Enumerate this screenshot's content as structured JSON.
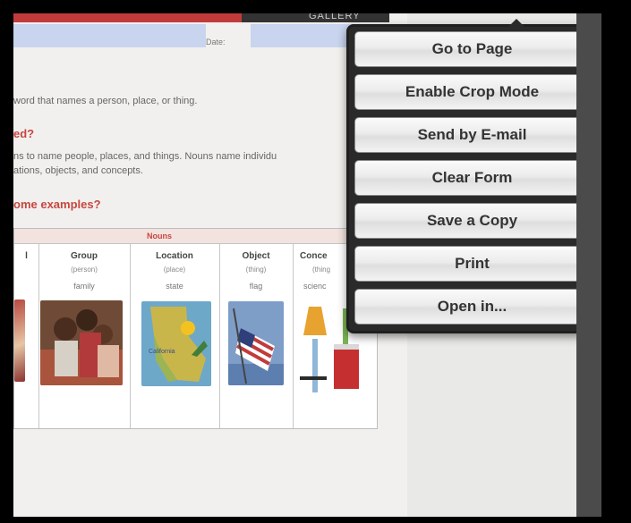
{
  "document": {
    "header_right_label": "GALLERY",
    "date_label": "Date:",
    "definition_text": "word that names a person, place, or thing.",
    "question_1": "ed?",
    "paragraph_line_1": "ns to name people, places, and things. Nouns name individu",
    "paragraph_line_2": "ations, objects, and concepts.",
    "question_2": "ome examples?",
    "table": {
      "title": "Nouns",
      "columns": [
        {
          "header": "l",
          "sub": "",
          "example": ""
        },
        {
          "header": "Group",
          "sub": "(person)",
          "example": "family"
        },
        {
          "header": "Location",
          "sub": "(place)",
          "example": "state"
        },
        {
          "header": "Object",
          "sub": "(thing)",
          "example": "flag"
        },
        {
          "header": "Conce",
          "sub": "(thing",
          "example": "scienc"
        }
      ],
      "map_label": "California"
    }
  },
  "menu": {
    "items": [
      {
        "label": "Go to Page"
      },
      {
        "label": "Enable Crop Mode"
      },
      {
        "label": "Send by E-mail"
      },
      {
        "label": "Clear Form"
      },
      {
        "label": "Save a Copy"
      },
      {
        "label": "Print"
      },
      {
        "label": "Open in..."
      }
    ]
  }
}
